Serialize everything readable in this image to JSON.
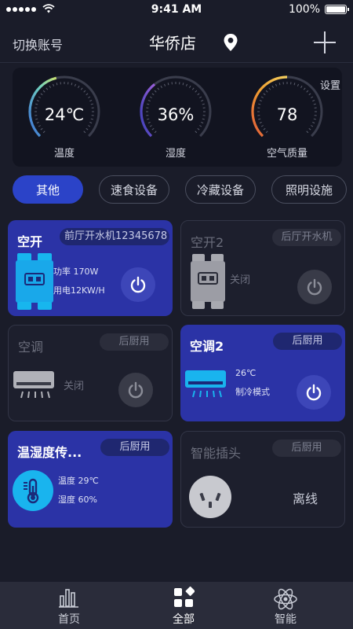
{
  "status_bar": {
    "time": "9:41 AM",
    "battery": "100%"
  },
  "nav": {
    "left": "切换账号",
    "title": "华侨店"
  },
  "env": {
    "settings": "设置",
    "gauges": [
      {
        "value": "24℃",
        "label": "温度",
        "level": 0.45
      },
      {
        "value": "36%",
        "label": "湿度",
        "level": 0.36
      },
      {
        "value": "78",
        "label": "空气质量",
        "level": 0.5
      }
    ]
  },
  "tabs": [
    "其他",
    "速食设备",
    "冷藏设备",
    "照明设施"
  ],
  "cards": [
    {
      "name": "空开",
      "location": "前厅开水机12345678",
      "info": [
        "功率 170W",
        "用电12KW/H"
      ],
      "state": "on"
    },
    {
      "name": "空开2",
      "location": "后厅开水机",
      "info": [
        "关闭"
      ],
      "state": "off"
    },
    {
      "name": "空调",
      "location": "后厨用",
      "info": [
        "关闭"
      ],
      "state": "off"
    },
    {
      "name": "空调2",
      "location": "后厨用",
      "info": [
        "26℃",
        "制冷模式"
      ],
      "state": "on"
    },
    {
      "name": "温湿度传...",
      "location": "后厨用",
      "info": [
        "温度 29℃",
        "湿度 60%"
      ],
      "state": "on"
    },
    {
      "name": "智能插头",
      "location": "后厨用",
      "info": [
        "离线"
      ],
      "state": "off"
    }
  ],
  "tabbar": [
    "首页",
    "全部",
    "智能"
  ],
  "colors": {
    "background": "#1a1c29",
    "accent": "#2b43c8",
    "card_on": "#2b33a6",
    "card_off": "#1d1f2d"
  }
}
